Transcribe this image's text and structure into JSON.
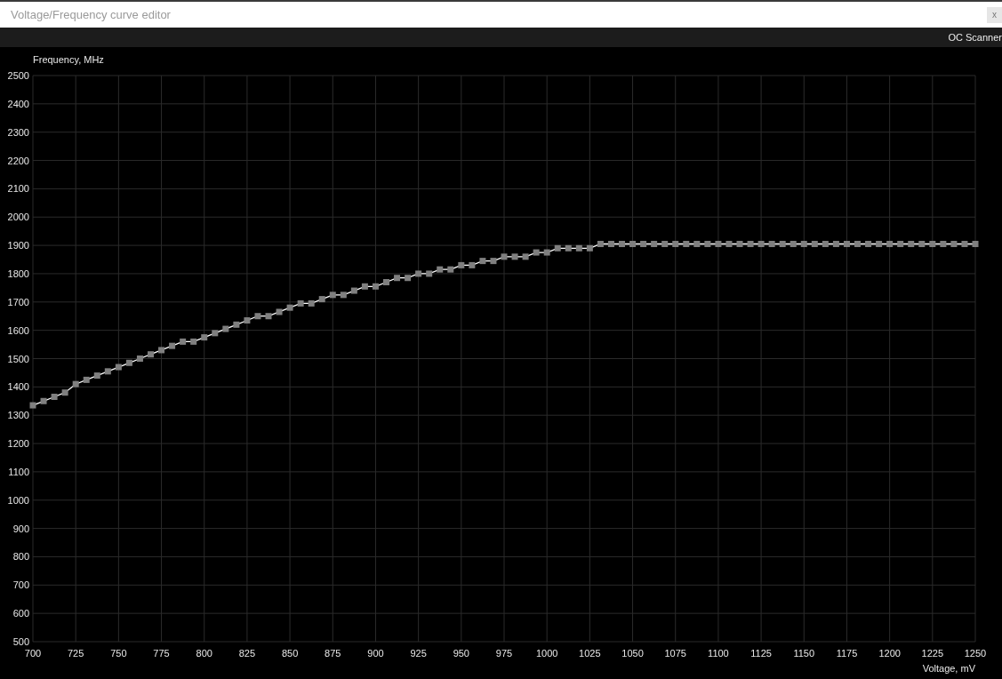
{
  "window": {
    "title": "Voltage/Frequency curve editor",
    "close_label": "x"
  },
  "toolbar": {
    "button": "OC Scanner"
  },
  "curve": {
    "chart_data": {
      "type": "line",
      "grid": true,
      "ylabel": "Frequency, MHz",
      "xlabel": "Voltage, mV",
      "xlim": [
        700,
        1250
      ],
      "ylim": [
        500,
        2500
      ],
      "xticks": [
        700,
        725,
        750,
        775,
        800,
        825,
        850,
        875,
        900,
        925,
        950,
        975,
        1000,
        1025,
        1050,
        1075,
        1100,
        1125,
        1150,
        1175,
        1200,
        1225,
        1250
      ],
      "yticks": [
        500,
        600,
        700,
        800,
        900,
        1000,
        1100,
        1200,
        1300,
        1400,
        1500,
        1600,
        1700,
        1800,
        1900,
        2000,
        2100,
        2200,
        2300,
        2400,
        2500
      ],
      "x": [
        700,
        706.25,
        712.5,
        718.75,
        725,
        731.25,
        737.5,
        743.75,
        750,
        756.25,
        762.5,
        768.75,
        775,
        781.25,
        787.5,
        793.75,
        800,
        806.25,
        812.5,
        818.75,
        825,
        831.25,
        837.5,
        843.75,
        850,
        856.25,
        862.5,
        868.75,
        875,
        881.25,
        887.5,
        893.75,
        900,
        906.25,
        912.5,
        918.75,
        925,
        931.25,
        937.5,
        943.75,
        950,
        956.25,
        962.5,
        968.75,
        975,
        981.25,
        987.5,
        993.75,
        1000,
        1006.25,
        1012.5,
        1018.75,
        1025,
        1031.25,
        1037.5,
        1043.75,
        1050,
        1056.25,
        1062.5,
        1068.75,
        1075,
        1081.25,
        1087.5,
        1093.75,
        1100,
        1106.25,
        1112.5,
        1118.75,
        1125,
        1131.25,
        1137.5,
        1143.75,
        1150,
        1156.25,
        1162.5,
        1168.75,
        1175,
        1181.25,
        1187.5,
        1193.75,
        1200,
        1206.25,
        1212.5,
        1218.75,
        1225,
        1231.25,
        1237.5,
        1243.75,
        1250
      ],
      "series": [
        {
          "color": "#ffffff",
          "marker": "square",
          "values": [
            1335,
            1350,
            1365,
            1380,
            1410,
            1425,
            1440,
            1455,
            1470,
            1485,
            1500,
            1515,
            1530,
            1545,
            1560,
            1560,
            1575,
            1590,
            1605,
            1620,
            1635,
            1650,
            1650,
            1665,
            1680,
            1695,
            1695,
            1710,
            1725,
            1725,
            1740,
            1755,
            1755,
            1770,
            1785,
            1785,
            1800,
            1800,
            1815,
            1815,
            1830,
            1830,
            1845,
            1845,
            1860,
            1860,
            1860,
            1875,
            1875,
            1890,
            1890,
            1890,
            1890,
            1905,
            1905,
            1905,
            1905,
            1905,
            1905,
            1905,
            1905,
            1905,
            1905,
            1905,
            1905,
            1905,
            1905,
            1905,
            1905,
            1905,
            1905,
            1905,
            1905,
            1905,
            1905,
            1905,
            1905,
            1905,
            1905,
            1905,
            1905,
            1905,
            1905,
            1905,
            1905,
            1905,
            1905,
            1905,
            1905
          ]
        }
      ]
    }
  }
}
